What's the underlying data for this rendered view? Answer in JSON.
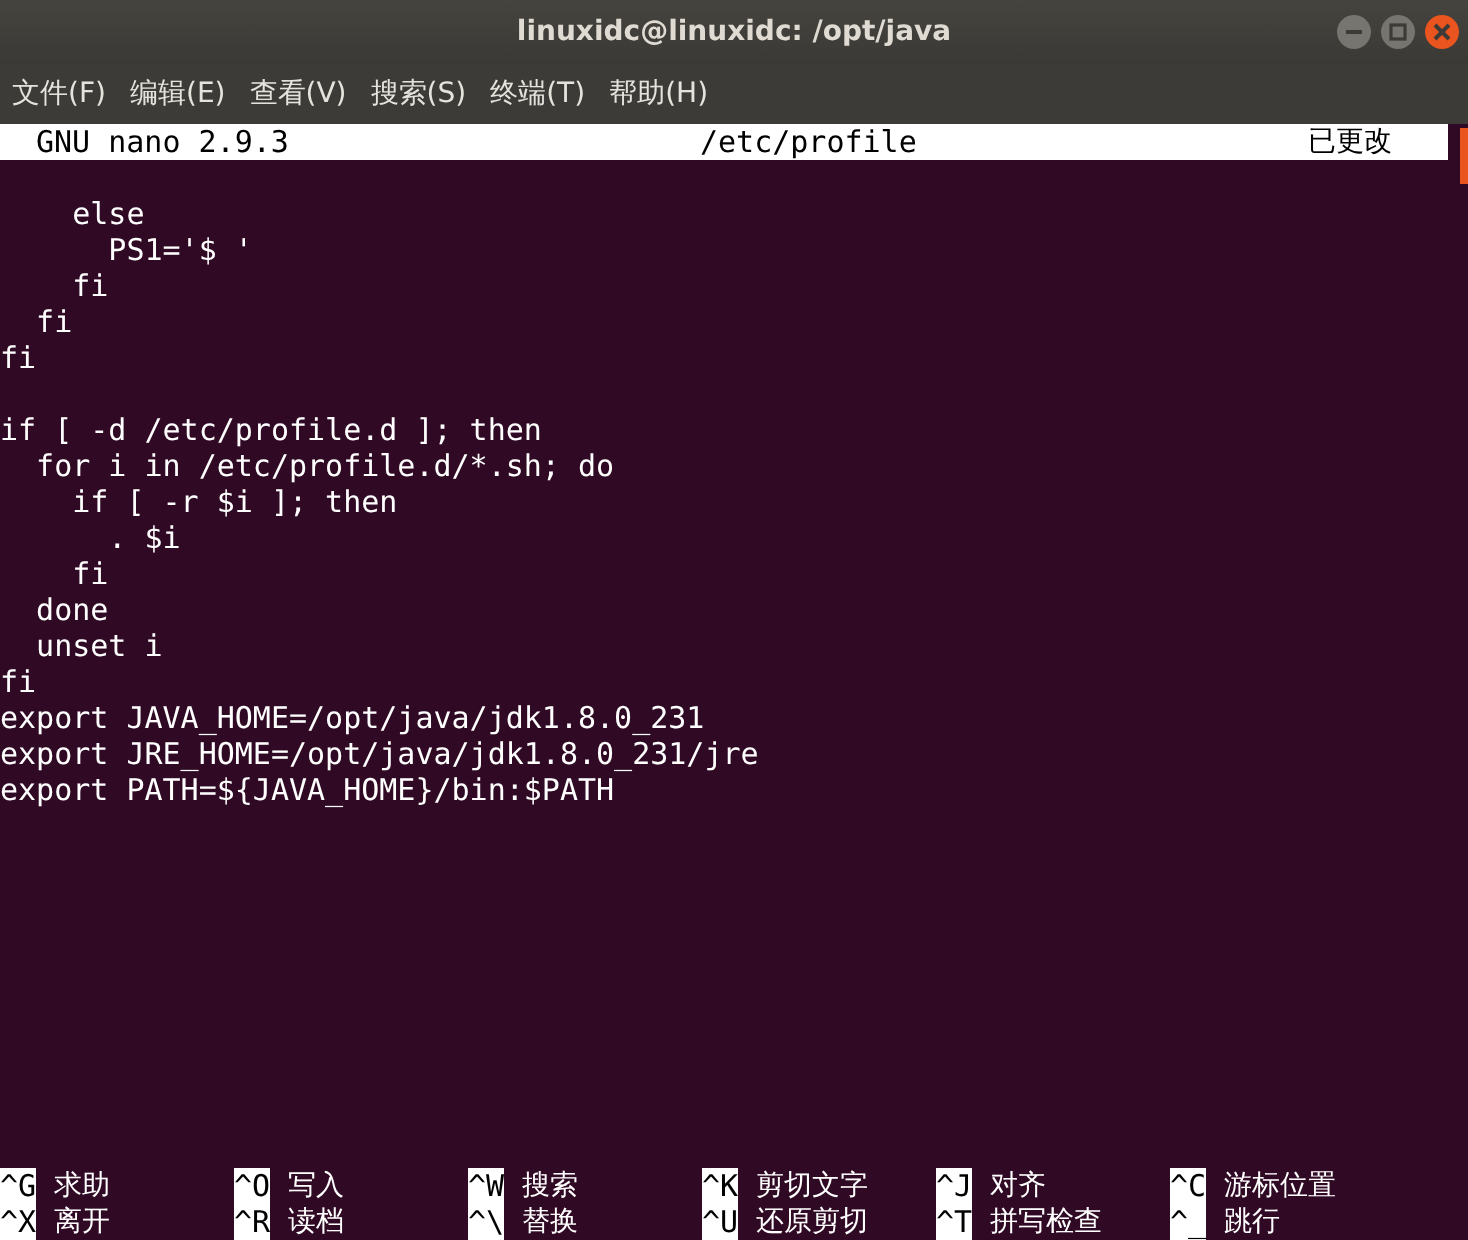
{
  "window": {
    "title": "linuxidc@linuxidc: /opt/java"
  },
  "menu": [
    "文件(F)",
    "编辑(E)",
    "查看(V)",
    "搜索(S)",
    "终端(T)",
    "帮助(H)"
  ],
  "nano_header": {
    "version": "GNU nano 2.9.3",
    "file": "/etc/profile",
    "status": "已更改"
  },
  "blocks": [
    [
      "    else",
      "      PS1='$ '",
      "    fi",
      "  fi",
      "fi"
    ],
    [
      "if [ -d /etc/profile.d ]; then",
      "  for i in /etc/profile.d/*.sh; do",
      "    if [ -r $i ]; then",
      "      . $i",
      "    fi",
      "  done",
      "  unset i",
      "fi",
      "export JAVA_HOME=/opt/java/jdk1.8.0_231",
      "export JRE_HOME=/opt/java/jdk1.8.0_231/jre",
      "export PATH=${JAVA_HOME}/bin:$PATH"
    ]
  ],
  "shortcuts": [
    [
      {
        "key": "^G",
        "label": "求助"
      },
      {
        "key": "^O",
        "label": "写入"
      },
      {
        "key": "^W",
        "label": "搜索"
      },
      {
        "key": "^K",
        "label": "剪切文字"
      },
      {
        "key": "^J",
        "label": "对齐"
      },
      {
        "key": "^C",
        "label": "游标位置"
      }
    ],
    [
      {
        "key": "^X",
        "label": "离开"
      },
      {
        "key": "^R",
        "label": "读档"
      },
      {
        "key": "^\\",
        "label": "替换"
      },
      {
        "key": "^U",
        "label": "还原剪切"
      },
      {
        "key": "^T",
        "label": "拼写检查"
      },
      {
        "key": "^_",
        "label": "跳行"
      }
    ]
  ]
}
